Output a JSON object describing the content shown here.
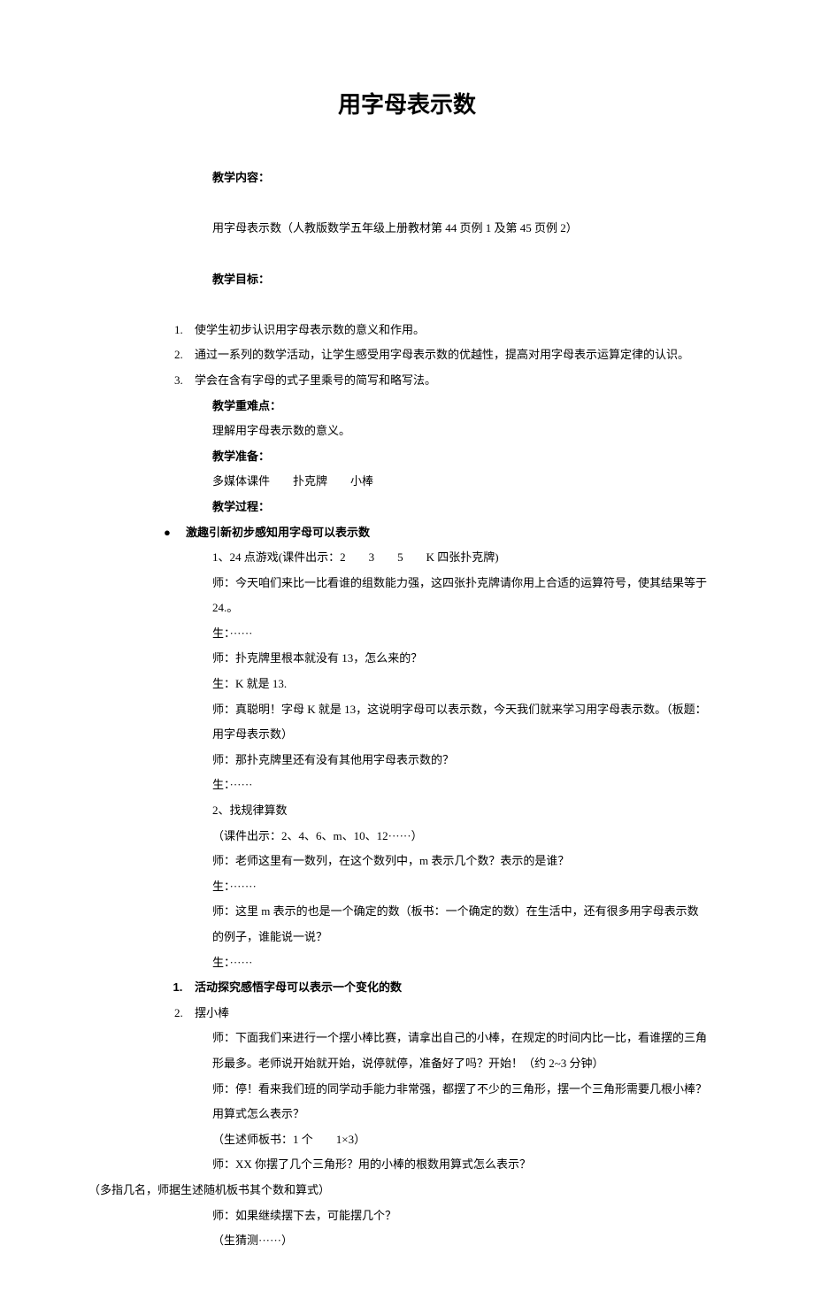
{
  "title": "用字母表示数",
  "h_content": "教学内容：",
  "content_text": "用字母表示数（人教版数学五年级上册教材第 44 页例 1 及第 45 页例 2）",
  "h_goal": "教学目标：",
  "goals": [
    "使学生初步认识用字母表示数的意义和作用。",
    "通过一系列的数学活动，让学生感受用字母表示数的优越性，提高对用字母表示运算定律的认识。",
    "学会在含有字母的式子里乘号的简写和略写法。"
  ],
  "h_diff": "教学重难点：",
  "diff_text": "理解用字母表示数的意义。",
  "h_prep": "教学准备：",
  "prep_text": "多媒体课件　　扑克牌　　小棒",
  "h_proc": "教学过程：",
  "sec1_head": "激趣引新初步感知用字母可以表示数",
  "sec1": [
    "1、24 点游戏(课件出示：2　　3　　5　　K 四张扑克牌)",
    "师：今天咱们来比一比看谁的组数能力强，这四张扑克牌请你用上合适的运算符号，使其结果等于 24.。",
    "生：······",
    "师：扑克牌里根本就没有 13，怎么来的？",
    "生：K 就是 13.",
    "师：真聪明！字母 K 就是 13，这说明字母可以表示数，今天我们就来学习用字母表示数。（板题：用字母表示数）",
    "师：那扑克牌里还有没有其他用字母表示数的？",
    "生：······",
    "2、找规律算数",
    "（课件出示：2、4、6、m、10、12······）",
    "师：老师这里有一数列，在这个数列中，m 表示几个数？表示的是谁？",
    "生：·······",
    "师：这里 m 表示的也是一个确定的数（板书：一个确定的数）在生活中，还有很多用字母表示数的例子，谁能说一说？",
    "生：······"
  ],
  "act1": "活动探究感悟字母可以表示一个变化的数",
  "act2": "摆小棒",
  "sec2": [
    "师：下面我们来进行一个摆小棒比赛，请拿出自己的小棒，在规定的时间内比一比，看谁摆的三角形最多。老师说开始就开始，说停就停，准备好了吗？开始！（约 2~3 分钟）",
    "师：停！看来我们班的同学动手能力非常强，都摆了不少的三角形，摆一个三角形需要几根小棒？用算式怎么表示？",
    "（生述师板书：1 个　　1×3）",
    "师：XX 你摆了几个三角形？用的小棒的根数用算式怎么表示？"
  ],
  "sec2_sub": "（多指几名，师据生述随机板书其个数和算式）",
  "sec2b": [
    "师：如果继续摆下去，可能摆几个？",
    "（生猜测······）"
  ]
}
